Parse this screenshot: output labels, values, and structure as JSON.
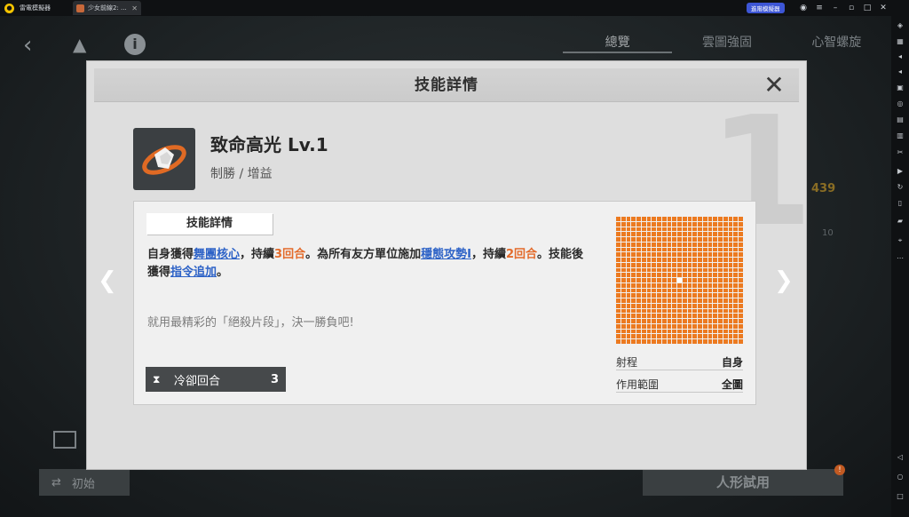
{
  "titlebar": {
    "app_name": "雷電模擬器",
    "tab_title": "少女前線2: ...",
    "sync_label": "進階模擬器"
  },
  "background": {
    "tabs": [
      "總覽",
      "雲圖強固",
      "心智螺旋"
    ],
    "value_439": "439",
    "value_10": "10",
    "reset_button": "初始",
    "trial_button": "人形試用",
    "badge": "!"
  },
  "modal": {
    "title": "技能詳情",
    "close_icon": "close-icon",
    "skill": {
      "name": "致命高光 Lv.1",
      "type": "制勝 / 增益",
      "big_level": "1"
    },
    "panel": {
      "label": "技能詳情",
      "desc": {
        "p1": "自身獲得",
        "kw1": "舞團核心",
        "p2": "，持續",
        "n1": "3回合",
        "p3": "。為所有友方單位施加",
        "kw2": "穩態攻勢I",
        "p4": "，持續",
        "n2": "2回合",
        "p5": "。技能後獲得",
        "kw3": "指令追加",
        "p6": "。"
      },
      "flavor": "就用最精彩的「絕殺片段」，決一勝負吧!",
      "cooldown": {
        "label": "冷卻回合",
        "value": "3"
      },
      "stats": [
        {
          "label": "射程",
          "value": "自身"
        },
        {
          "label": "作用範圍",
          "value": "全圖"
        }
      ]
    }
  },
  "colors": {
    "keyword": "#2e63c7",
    "number": "#e36b2b",
    "grid": "#ec7a20"
  }
}
